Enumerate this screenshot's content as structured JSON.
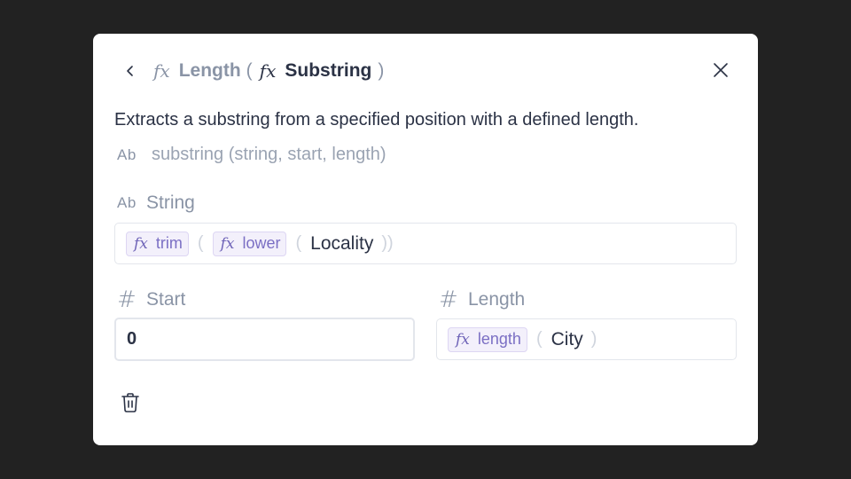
{
  "header": {
    "back_icon": "chevron-left-icon",
    "close_icon": "close-icon",
    "outer_fx": "𝑓𝑥",
    "outer_function": "Length",
    "open_paren": "(",
    "inner_fx": "𝑓𝑥",
    "inner_function": "Substring",
    "close_paren": ")"
  },
  "description": "Extracts a substring from a specified position with a defined length.",
  "signature": {
    "type_icon": "Ab",
    "text": "substring (string, start, length)"
  },
  "params": {
    "string": {
      "type_icon": "Ab",
      "label": "String",
      "outer_chip": {
        "fx": "𝑓𝑥",
        "name": "trim"
      },
      "inner_chip": {
        "fx": "𝑓𝑥",
        "name": "lower"
      },
      "open_paren": "(",
      "value": "Locality",
      "close_parens": "))"
    },
    "start": {
      "type_icon": "#",
      "label": "Start",
      "value": "0"
    },
    "length": {
      "type_icon": "#",
      "label": "Length",
      "chip": {
        "fx": "𝑓𝑥",
        "name": "length"
      },
      "open_paren": "(",
      "value": "City",
      "close_paren": ")"
    }
  },
  "footer": {
    "delete_icon": "trash-icon"
  },
  "colors": {
    "backdrop": "#222222",
    "modal": "#ffffff",
    "text_dark": "#2b3245",
    "text_muted": "#8a94a6",
    "chip_bg": "#f3f0fb",
    "chip_text": "#7b6fc4",
    "border": "#e3e6ec"
  }
}
